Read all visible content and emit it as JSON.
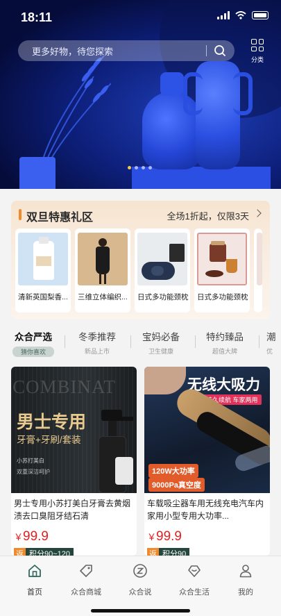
{
  "status_bar": {
    "time": "18:11"
  },
  "search": {
    "placeholder": "更多好物，待您探索"
  },
  "category": {
    "label": "分类"
  },
  "banner": {
    "slide_count": 4,
    "active_index": 0
  },
  "promo": {
    "title": "双旦特惠礼区",
    "subtitle": "全场1折起，仅限3天",
    "products": [
      {
        "name": "清新英国梨香..."
      },
      {
        "name": "三维立体编织..."
      },
      {
        "name": "日式多功能颈枕"
      },
      {
        "name": "日式多功能颈枕"
      }
    ]
  },
  "tabs": [
    {
      "title": "众合严选",
      "subtitle": "猜你喜欢"
    },
    {
      "title": "冬季推荐",
      "subtitle": "新品上市"
    },
    {
      "title": "宝妈必备",
      "subtitle": "卫生健康"
    },
    {
      "title": "特约臻品",
      "subtitle": "超值大牌"
    },
    {
      "title": "潮",
      "subtitle": "优"
    }
  ],
  "feed": [
    {
      "image_text": {
        "bg_word": "COMBINAT",
        "headline": "男士专用",
        "subline": "牙膏+牙刷/套装",
        "note1": "小苏打美白",
        "note2": "双重深洁呵护"
      },
      "description": "男士专用小苏打美白牙膏去黄烟渍去口臭阻牙结石清",
      "currency": "￥",
      "price": "99.9",
      "return_tag": "返",
      "points": "积分90~120"
    },
    {
      "image_text": {
        "headline": "无线大吸力",
        "tag": "持久续航 车家两用",
        "power": "120W大功率",
        "suction": "9000Pa真空度"
      },
      "description": "车载吸尘器车用无线充电汽车内家用小型专用大功率...",
      "currency": "￥",
      "price": "99.9",
      "return_tag": "返",
      "points": "积分90"
    }
  ],
  "bottom_nav": [
    {
      "label": "首页",
      "icon": "home-icon"
    },
    {
      "label": "众合商城",
      "icon": "tag-icon"
    },
    {
      "label": "众合说",
      "icon": "z-circle-icon"
    },
    {
      "label": "众合生活",
      "icon": "heart-diamond-icon"
    },
    {
      "label": "我的",
      "icon": "user-icon"
    }
  ],
  "colors": {
    "accent": "#f08a2a",
    "price": "#e02020",
    "dark_green": "#24463c",
    "hero_blue": "#1f3fb8"
  }
}
